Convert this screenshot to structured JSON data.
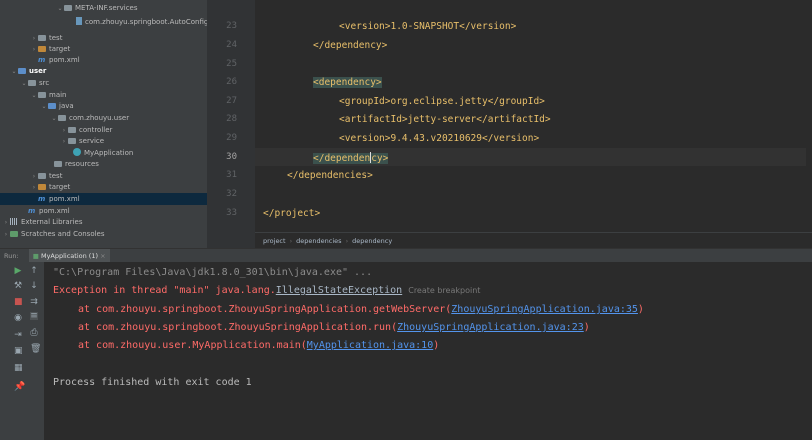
{
  "project_tree": {
    "items": [
      {
        "label": "META-INF.services",
        "arrow": "⌄",
        "icon": "folder"
      },
      {
        "label": "com.zhouyu.springboot.AutoConfiguration",
        "arrow": "",
        "icon": "file"
      },
      {
        "label": "test",
        "arrow": "›",
        "icon": "folder"
      },
      {
        "label": "target",
        "arrow": "›",
        "icon": "folder-orange"
      },
      {
        "label": "pom.xml",
        "arrow": "",
        "icon": "maven"
      },
      {
        "label": "user",
        "arrow": "⌄",
        "icon": "module"
      },
      {
        "label": "src",
        "arrow": "⌄",
        "icon": "folder"
      },
      {
        "label": "main",
        "arrow": "⌄",
        "icon": "folder"
      },
      {
        "label": "java",
        "arrow": "⌄",
        "icon": "folder-blue"
      },
      {
        "label": "com.zhouyu.user",
        "arrow": "⌄",
        "icon": "folder"
      },
      {
        "label": "controller",
        "arrow": "›",
        "icon": "folder"
      },
      {
        "label": "service",
        "arrow": "›",
        "icon": "folder"
      },
      {
        "label": "MyApplication",
        "arrow": "",
        "icon": "class"
      },
      {
        "label": "resources",
        "arrow": "",
        "icon": "folder"
      },
      {
        "label": "test",
        "arrow": "›",
        "icon": "folder"
      },
      {
        "label": "target",
        "arrow": "›",
        "icon": "folder-orange"
      },
      {
        "label": "pom.xml",
        "arrow": "",
        "icon": "maven"
      },
      {
        "label": "pom.xml",
        "arrow": "",
        "icon": "maven"
      },
      {
        "label": "External Libraries",
        "arrow": "›",
        "icon": "library"
      },
      {
        "label": "Scratches and Consoles",
        "arrow": "›",
        "icon": "scratch"
      }
    ]
  },
  "editor": {
    "line_numbers": [
      "23",
      "24",
      "25",
      "26",
      "27",
      "28",
      "29",
      "30",
      "31",
      "32",
      "33"
    ],
    "current_line": "30",
    "lines": [
      {
        "text": "<version>1.0-SNAPSHOT</version>"
      },
      {
        "text": "</dependency>"
      },
      {
        "text": ""
      },
      {
        "text": "<dependency>"
      },
      {
        "text": "<groupId>org.eclipse.jetty</groupId>"
      },
      {
        "text": "<artifactId>jetty-server</artifactId>"
      },
      {
        "text": "<version>9.4.43.v20210629</version>"
      },
      {
        "text_before_caret": "</dependen",
        "text_after_caret": "cy>"
      },
      {
        "text": "</dependencies>"
      },
      {
        "text": ""
      },
      {
        "text": "</project>"
      }
    ]
  },
  "breadcrumb": [
    "project",
    "dependencies",
    "dependency"
  ],
  "run_panel": {
    "label": "Run:",
    "tab": "MyApplication (1)",
    "tab_close": "×"
  },
  "console": {
    "command": "\"C:\\Program Files\\Java\\jdk1.8.0_301\\bin\\java.exe\" ...",
    "exception_prefix": "Exception in thread \"main\" java.lang.",
    "exception_class": "IllegalStateException",
    "create_breakpoint": "Create breakpoint",
    "stack": [
      {
        "prefix": "at com.zhouyu.springboot.ZhouyuSpringApplication.getWebServer(",
        "link": "ZhouyuSpringApplication.java:35",
        "suffix": ")"
      },
      {
        "prefix": "at com.zhouyu.springboot.ZhouyuSpringApplication.run(",
        "link": "ZhouyuSpringApplication.java:23",
        "suffix": ")"
      },
      {
        "prefix": "at com.zhouyu.user.MyApplication.main(",
        "link": "MyApplication.java:10",
        "suffix": ")"
      }
    ],
    "exit_message": "Process finished with exit code 1"
  },
  "colors": {
    "tag": "#e8bf6a",
    "error": "#ff6b68",
    "link": "#5394ec",
    "background": "#2b2b2b"
  }
}
